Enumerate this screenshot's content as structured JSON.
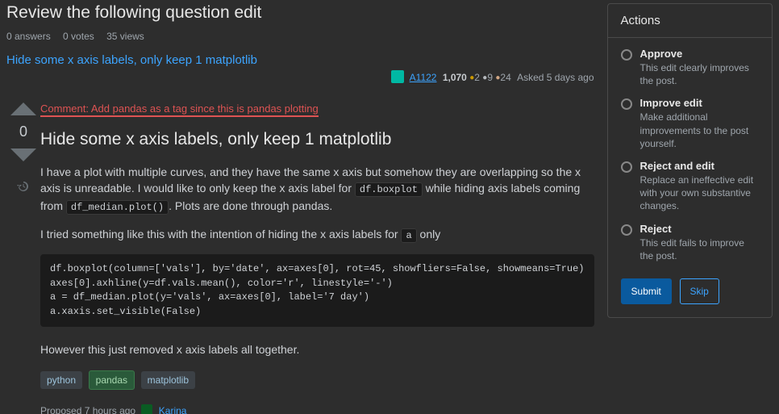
{
  "header": {
    "title": "Review the following question edit",
    "stats": {
      "answers": "0 answers",
      "votes": "0 votes",
      "views": "35 views"
    },
    "question_link": "Hide some x axis labels, only keep 1 matplotlib"
  },
  "author": {
    "name": "A1122",
    "rep": "1,070",
    "gold": "2",
    "silver": "9",
    "bronze": "24",
    "asked": "Asked 5 days ago"
  },
  "post": {
    "score": "0",
    "comment_prefix": "Comment:",
    "comment_text": " Add pandas as a tag since this is pandas plotting",
    "title": "Hide some x axis labels, only keep 1 matplotlib",
    "p1_a": "I have a plot with multiple curves, and they have the same x axis but somehow they are overlapping so the x axis is unreadable. I would like to only keep the x axis label for ",
    "code1": "df.boxplot",
    "p1_b": " while hiding axis labels coming from ",
    "code2": "df_median.plot()",
    "p1_c": ". Plots are done through pandas.",
    "p2_a": "I tried something like this with the intention of hiding the x axis labels for ",
    "code3": "a",
    "p2_b": " only",
    "codeblock": "df.boxplot(column=['vals'], by='date', ax=axes[0], rot=45, showfliers=False, showmeans=True)\naxes[0].axhline(y=df.vals.mean(), color='r', linestyle='-')\na = df_median.plot(y='vals', ax=axes[0], label='7 day')\na.xaxis.set_visible(False)",
    "p3": "However this just removed x axis labels all together.",
    "tags": [
      "python",
      "pandas",
      "matplotlib"
    ],
    "added_tag_index": 1,
    "proposed_prefix": "Proposed 7 hours ago",
    "proposer": "Karina"
  },
  "sidebar": {
    "title": "Actions",
    "options": [
      {
        "label": "Approve",
        "desc": "This edit clearly improves the post."
      },
      {
        "label": "Improve edit",
        "desc": "Make additional improvements to the post yourself."
      },
      {
        "label": "Reject and edit",
        "desc": "Replace an ineffective edit with your own substantive changes."
      },
      {
        "label": "Reject",
        "desc": "This edit fails to improve the post."
      }
    ],
    "submit": "Submit",
    "skip": "Skip"
  }
}
